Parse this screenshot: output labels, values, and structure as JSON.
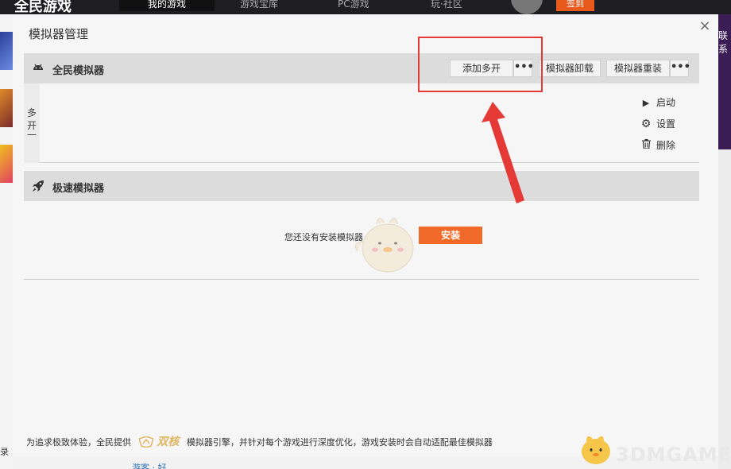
{
  "background": {
    "brand": "全民游戏",
    "tabs": [
      "我的游戏",
      "游戏宝库",
      "PC游戏",
      "玩·社区"
    ],
    "sign_label": "签到",
    "right_text": "联系",
    "bottom_text": "游客 · 好",
    "left_text": "录"
  },
  "dialog": {
    "title": "模拟器管理",
    "close_label": "×"
  },
  "section1": {
    "title": "全民模拟器",
    "buttons": {
      "add_multi": "添加多开",
      "more1": "•••",
      "uninstall": "模拟器卸载",
      "reinstall": "模拟器重装",
      "more2": "•••"
    },
    "instance_label_chars": [
      "多",
      "开",
      "一"
    ],
    "actions": {
      "start": "启动",
      "settings": "设置",
      "delete": "删除"
    }
  },
  "section2": {
    "title": "极速模拟器",
    "empty_text": "您还没有安装模拟器",
    "install_label": "安装"
  },
  "footer": {
    "text_before": "为追求极致体验，全民提供",
    "logo_text": "双核",
    "text_after": "模拟器引擎，并针对每个游戏进行深度优化，游戏安装时会自动适配最佳模拟器"
  },
  "watermark": {
    "text": "3DMGAME"
  },
  "colors": {
    "accent": "#f26a2a",
    "highlight": "#e53935",
    "header_bg": "#dcdcdc"
  }
}
